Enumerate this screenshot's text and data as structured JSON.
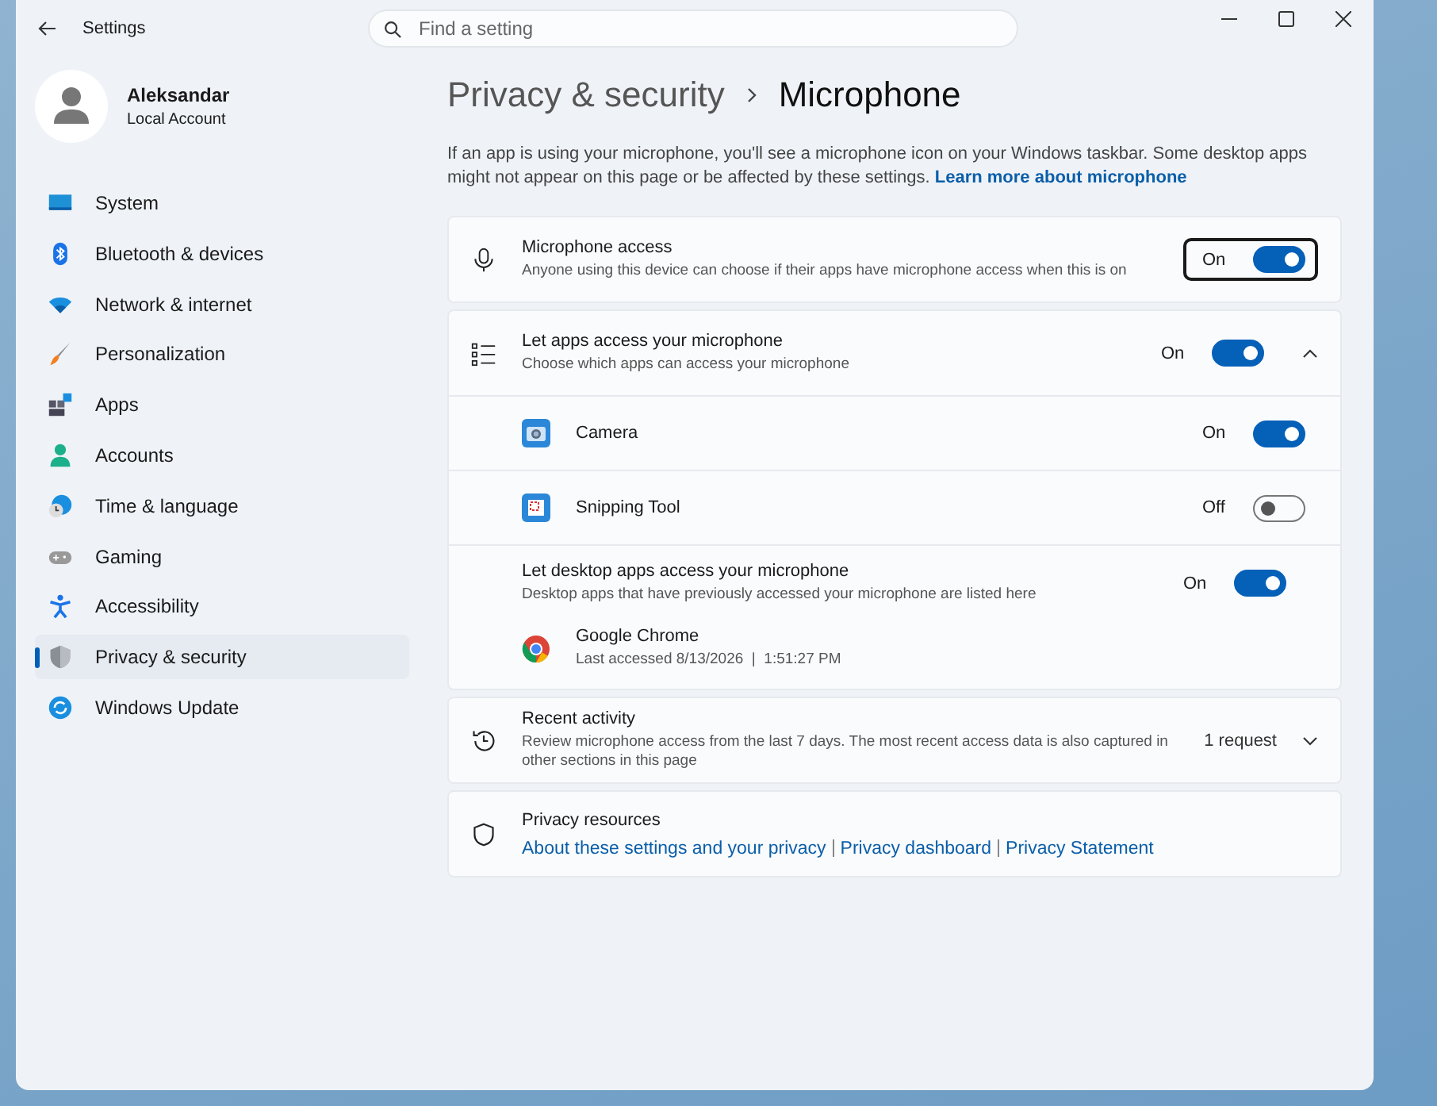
{
  "window": {
    "title": "Settings"
  },
  "search": {
    "placeholder": "Find a setting"
  },
  "account": {
    "name": "Aleksandar",
    "type": "Local Account"
  },
  "nav": [
    {
      "label": "System",
      "selected": false
    },
    {
      "label": "Bluetooth & devices",
      "selected": false
    },
    {
      "label": "Network & internet",
      "selected": false
    },
    {
      "label": "Personalization",
      "selected": false
    },
    {
      "label": "Apps",
      "selected": false
    },
    {
      "label": "Accounts",
      "selected": false
    },
    {
      "label": "Time & language",
      "selected": false
    },
    {
      "label": "Gaming",
      "selected": false
    },
    {
      "label": "Accessibility",
      "selected": false
    },
    {
      "label": "Privacy & security",
      "selected": true
    },
    {
      "label": "Windows Update",
      "selected": false
    }
  ],
  "breadcrumb": {
    "parent": "Privacy & security",
    "current": "Microphone"
  },
  "description": {
    "text": "If an app is using your microphone, you'll see a microphone icon on your Windows taskbar. Some desktop apps might not appear on this page or be affected by these settings.",
    "link": "Learn more about microphone"
  },
  "microphone_access": {
    "title": "Microphone access",
    "subtitle": "Anyone using this device can choose if their apps have microphone access when this is on",
    "state": "On",
    "on": true,
    "focused": true
  },
  "app_access": {
    "title": "Let apps access your microphone",
    "subtitle": "Choose which apps can access your microphone",
    "state": "On",
    "on": true,
    "expanded": true,
    "apps": [
      {
        "name": "Camera",
        "state": "On",
        "on": true
      },
      {
        "name": "Snipping Tool",
        "state": "Off",
        "on": false
      }
    ],
    "desktop": {
      "title": "Let desktop apps access your microphone",
      "subtitle": "Desktop apps that have previously accessed your microphone are listed here",
      "state": "On",
      "on": true,
      "apps": [
        {
          "name": "Google Chrome",
          "detail": "Last accessed 8/13/2026  |  1:51:27 PM"
        }
      ]
    }
  },
  "recent_activity": {
    "title": "Recent activity",
    "subtitle": "Review microphone access from the last 7 days. The most recent access data is also captured in other sections in this page",
    "count": "1 request",
    "expanded": false
  },
  "privacy_resources": {
    "title": "Privacy resources",
    "links": [
      "About these settings and your privacy",
      "Privacy dashboard",
      "Privacy Statement"
    ]
  }
}
